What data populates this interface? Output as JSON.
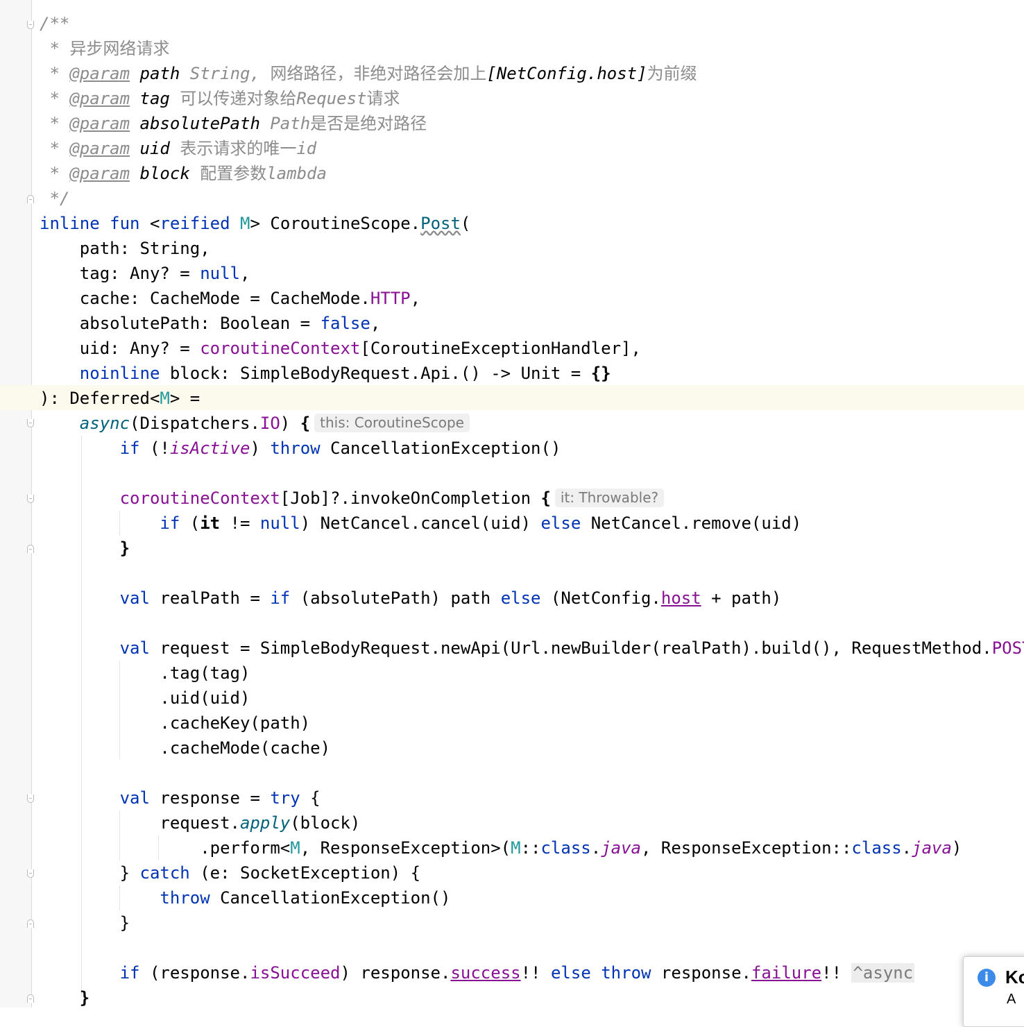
{
  "kdoc": {
    "open": "/**",
    "summary": "异步网络请求",
    "tag": "@param",
    "params": [
      {
        "name": "path",
        "type": "String",
        "desc": " 网络路径，非绝对路径会加上",
        "link": "[NetConfig.host]",
        "tail": "为前缀"
      },
      {
        "name": "tag",
        "desc1": "可以传递对象给",
        "ref": "Request",
        "desc2": "请求"
      },
      {
        "name": "absolutePath",
        "type": "Path",
        "desc": "是否是绝对路径"
      },
      {
        "name": "uid",
        "desc": "表示请求的唯一",
        "ref": "id"
      },
      {
        "name": "block",
        "desc": "配置参数",
        "ref": "lambda"
      }
    ],
    "close": "*/"
  },
  "hints": {
    "async_receiver": "this: CoroutineScope",
    "completion_param": "it: Throwable?",
    "async_label": "^async"
  },
  "popup": {
    "icon": "info-icon",
    "title": "Ko",
    "subtitle": "A"
  },
  "colors": {
    "keyword": "#0033b3",
    "comment": "#8c8c8c",
    "type_param": "#20999d",
    "property": "#871094",
    "function_call": "#00627a",
    "caret_row": "#fcfaed"
  }
}
